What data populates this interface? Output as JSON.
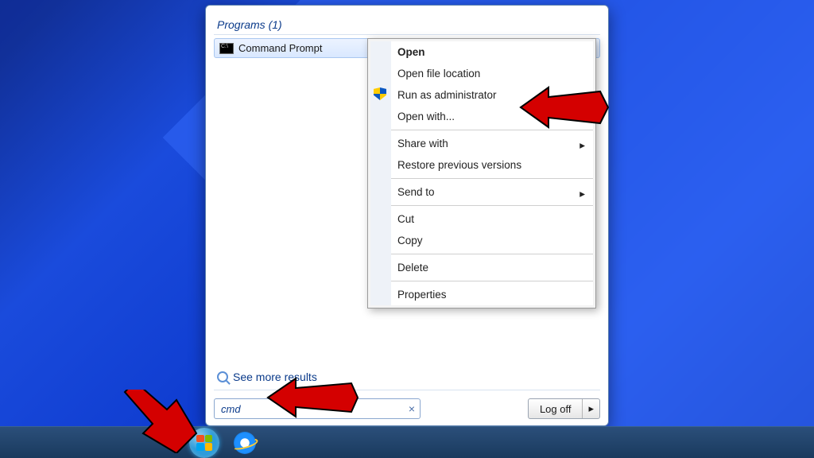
{
  "panel": {
    "section_header": "Programs (1)",
    "result_label": "Command Prompt",
    "see_more": "See more results",
    "search_value": "cmd",
    "logoff_label": "Log off"
  },
  "context_menu": {
    "open": "Open",
    "open_location": "Open file location",
    "run_admin": "Run as administrator",
    "open_with": "Open with...",
    "share_with": "Share with",
    "restore": "Restore previous versions",
    "send_to": "Send to",
    "cut": "Cut",
    "copy": "Copy",
    "delete": "Delete",
    "properties": "Properties"
  }
}
